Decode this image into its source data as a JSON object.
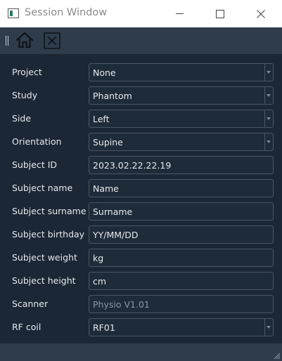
{
  "window": {
    "title": "Session Window",
    "controls": {
      "minimize": "minimize",
      "maximize": "maximize",
      "close": "close"
    }
  },
  "toolbar": {
    "icons": [
      "home-icon",
      "close-session-icon"
    ]
  },
  "form": {
    "project": {
      "label": "Project",
      "value": "None"
    },
    "study": {
      "label": "Study",
      "value": "Phantom"
    },
    "side": {
      "label": "Side",
      "value": "Left"
    },
    "orientation": {
      "label": "Orientation",
      "value": "Supine"
    },
    "subject_id": {
      "label": "Subject ID",
      "value": "2023.02.22.22.19"
    },
    "subject_name": {
      "label": "Subject name",
      "placeholder": "Name"
    },
    "subject_surname": {
      "label": "Subject surname",
      "placeholder": "Surname"
    },
    "subject_birthday": {
      "label": "Subject birthday",
      "placeholder": "YY/MM/DD"
    },
    "subject_weight": {
      "label": "Subject weight",
      "placeholder": "kg"
    },
    "subject_height": {
      "label": "Subject height",
      "placeholder": "cm"
    },
    "scanner": {
      "label": "Scanner",
      "value": "Physio V1.01"
    },
    "rf_coil": {
      "label": "RF coil",
      "value": "RF01"
    }
  },
  "colors": {
    "background": "#1b2734",
    "toolbar": "#2f3c4b",
    "field_border": "#4b5663",
    "text": "#e4e9ee"
  }
}
